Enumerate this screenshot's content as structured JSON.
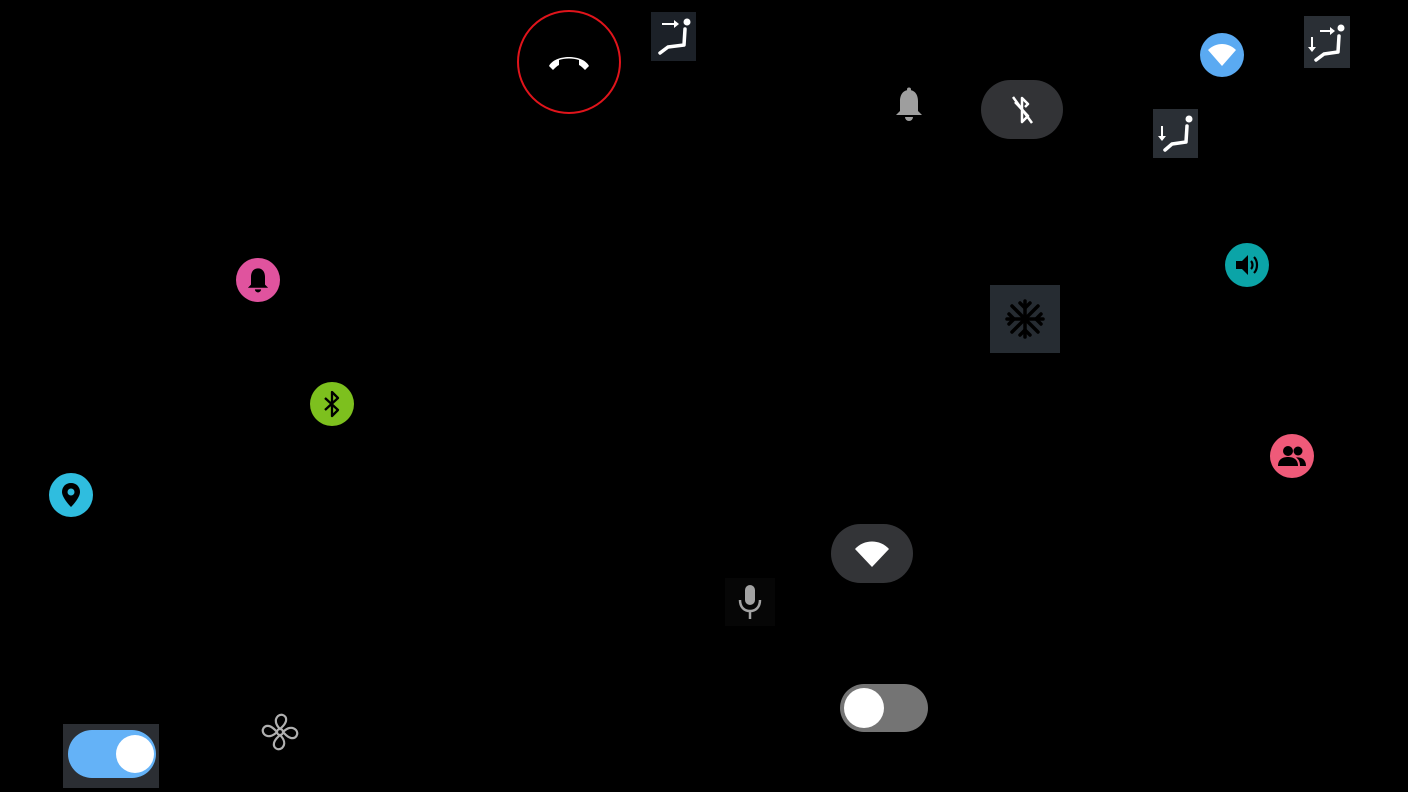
{
  "screen": {
    "background": "#000000"
  },
  "controls": {
    "end_call": {
      "icon": "end-call-icon",
      "border_color": "#e0141b"
    },
    "seat_move_right": {
      "icon": "seat-move-right-icon"
    },
    "seat_move_both": {
      "icon": "seat-move-both-icon"
    },
    "seat_recline": {
      "icon": "seat-recline-icon"
    },
    "notifications_grey": {
      "icon": "bell-icon",
      "color": "#9e9e9e"
    },
    "bluetooth_off": {
      "icon": "bluetooth-off-icon",
      "state": "off"
    },
    "wifi_blue": {
      "icon": "wifi-icon",
      "color": "#5aaaf2"
    },
    "notifications_pink": {
      "icon": "bell-icon",
      "color": "#e0539e"
    },
    "volume": {
      "icon": "volume-icon",
      "color": "#0ba4a7"
    },
    "defrost": {
      "icon": "snowflake-icon"
    },
    "bluetooth_green": {
      "icon": "bluetooth-icon",
      "color": "#7dc01e"
    },
    "location": {
      "icon": "location-pin-icon",
      "color": "#2fbddf"
    },
    "contacts": {
      "icon": "people-icon",
      "color": "#ef5a79"
    },
    "wifi_pill": {
      "icon": "wifi-icon"
    },
    "microphone": {
      "icon": "microphone-icon"
    },
    "fan": {
      "icon": "fan-icon"
    },
    "toggle_left": {
      "state": "on",
      "color": "#64b2f7"
    },
    "toggle_right": {
      "state": "off",
      "color": "#747474"
    }
  }
}
